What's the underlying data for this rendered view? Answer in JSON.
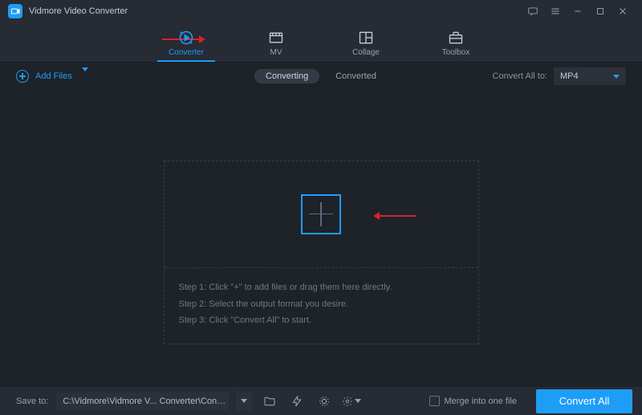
{
  "titlebar": {
    "app_name": "Vidmore Video Converter"
  },
  "nav": {
    "tabs": [
      {
        "label": "Converter",
        "icon": "converter-icon"
      },
      {
        "label": "MV",
        "icon": "mv-icon"
      },
      {
        "label": "Collage",
        "icon": "collage-icon"
      },
      {
        "label": "Toolbox",
        "icon": "toolbox-icon"
      }
    ],
    "active_index": 0
  },
  "subbar": {
    "add_files_label": "Add Files",
    "tabs": {
      "converting": "Converting",
      "converted": "Converted",
      "active": "converting"
    },
    "convert_all_label": "Convert All to:",
    "format_selected": "MP4"
  },
  "dropzone": {
    "steps": [
      "Step 1: Click \"+\" to add files or drag them here directly.",
      "Step 2: Select the output format you desire.",
      "Step 3: Click \"Convert All\" to start."
    ]
  },
  "bottombar": {
    "save_to_label": "Save to:",
    "save_path": "C:\\Vidmore\\Vidmore V... Converter\\Converted",
    "merge_label": "Merge into one file",
    "convert_button": "Convert All"
  },
  "annotations": {
    "arrow_color": "#d6222b"
  }
}
